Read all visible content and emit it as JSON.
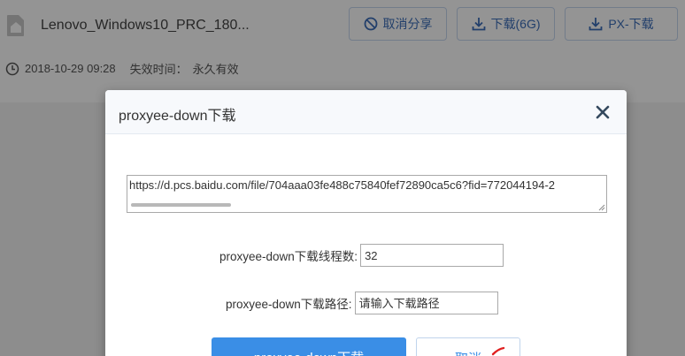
{
  "file": {
    "name": "Lenovo_Windows10_PRC_180...",
    "date": "2018-10-29 09:28",
    "expire_label": "失效时间：",
    "expire_value": "永久有效"
  },
  "toolbar": {
    "cancel_share": "取消分享",
    "download": "下载(6G)",
    "px_download": "PX-下载"
  },
  "dialog": {
    "title": "proxyee-down下载",
    "url": "https://d.pcs.baidu.com/file/704aaa03fe488c75840fef72890ca5c6?fid=772044194-2",
    "threads_label": "proxyee-down下载线程数:",
    "threads_value": "32",
    "path_label": "proxyee-down下载路径:",
    "path_placeholder": "请输入下载路径",
    "confirm_label": "proxyee-down下载",
    "cancel_label": "取消"
  },
  "colors": {
    "accent": "#3a8ee6",
    "overlay": "rgba(0,0,0,0.42)"
  }
}
